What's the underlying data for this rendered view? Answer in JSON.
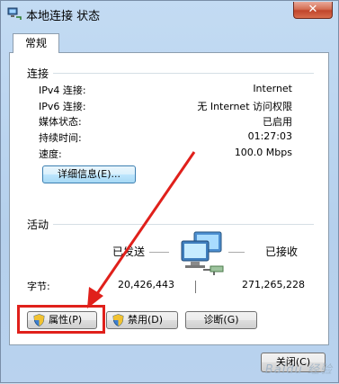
{
  "window": {
    "title": "本地连接 状态",
    "close_glyph": "✕"
  },
  "tabs": [
    {
      "label": "常规",
      "active": true
    }
  ],
  "connection": {
    "section_label": "连接",
    "rows": [
      {
        "label": "IPv4 连接:",
        "value": "Internet"
      },
      {
        "label": "IPv6 连接:",
        "value": "无 Internet 访问权限"
      },
      {
        "label": "媒体状态:",
        "value": "已启用"
      },
      {
        "label": "持续时间:",
        "value": "01:27:03"
      },
      {
        "label": "速度:",
        "value": "100.0 Mbps"
      }
    ],
    "details_button": "详细信息(E)..."
  },
  "activity": {
    "section_label": "活动",
    "sent_label": "已发送",
    "received_label": "已接收",
    "bytes_label": "字节:",
    "bytes_sent": "20,426,443",
    "bytes_received": "271,265,228"
  },
  "buttons": {
    "properties": "属性(P)",
    "disable": "禁用(D)",
    "diagnose": "诊断(G)",
    "close": "关闭(C)"
  },
  "icons": {
    "app": "network-connection-icon",
    "network_activity": "network-computers-icon",
    "uac": "uac-shield-icon"
  },
  "annotation": {
    "highlight_color": "#e0201b"
  },
  "watermark": "Baidu 经验"
}
